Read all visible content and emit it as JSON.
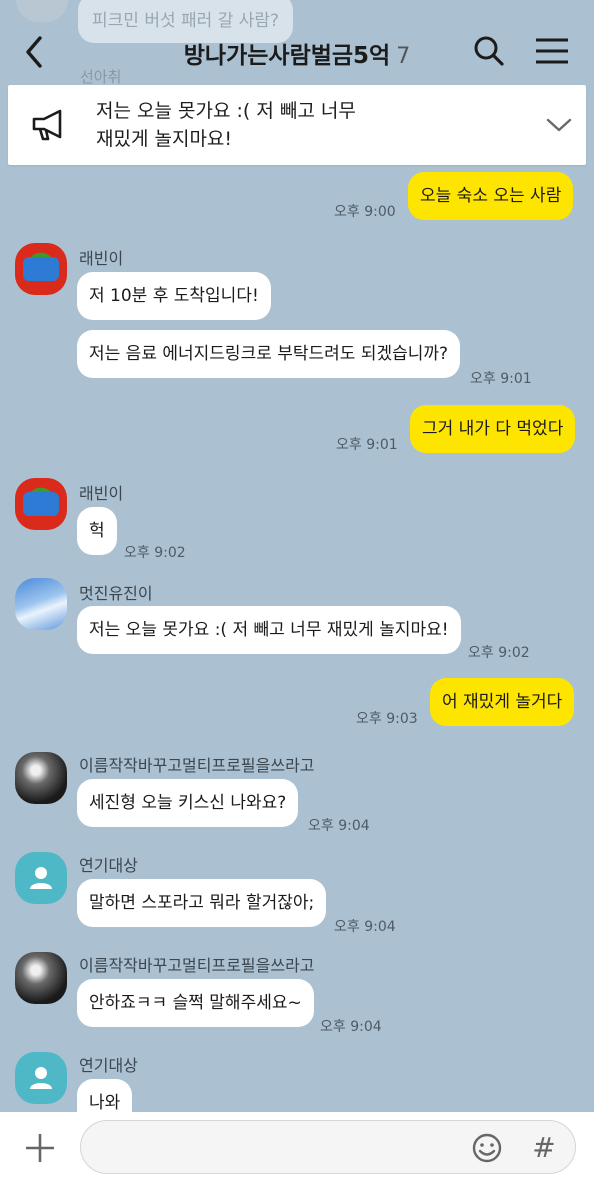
{
  "previous": {
    "text": "피크민 버섯 패러 갈 사람?",
    "sender": "선아취"
  },
  "header": {
    "title": "방나가는사람벌금5억",
    "member_count": "7"
  },
  "notice": {
    "text_line1": "저는 오늘 못가요 :( 저 빼고 너무",
    "text_line2": "재밌게 놀지마요!"
  },
  "messages": [
    {
      "type": "mine",
      "text": "오늘 숙소 오는 사람",
      "time": "오후 9:00"
    },
    {
      "type": "theirs",
      "sender": "래빈이",
      "text": "저 10분 후 도착입니다!",
      "time": ""
    },
    {
      "type": "theirs",
      "sender": "",
      "text": "저는 음료 에너지드링크로 부탁드려도 되겠습니까?",
      "time": "오후 9:01"
    },
    {
      "type": "mine",
      "text": "그거 내가 다 먹었다",
      "time": "오후 9:01"
    },
    {
      "type": "theirs",
      "sender": "래빈이",
      "text": "헉",
      "time": "오후 9:02"
    },
    {
      "type": "theirs",
      "sender": "멋진유진이",
      "text": "저는 오늘 못가요 :( 저 빼고 너무 재밌게 놀지마요!",
      "time": "오후 9:02"
    },
    {
      "type": "mine",
      "text": "어 재밌게 놀거다",
      "time": "오후 9:03"
    },
    {
      "type": "theirs",
      "sender": "이름작작바꾸고멀티프로필을쓰라고",
      "text": "세진형 오늘 키스신 나와요?",
      "time": "오후 9:04"
    },
    {
      "type": "theirs",
      "sender": "연기대상",
      "text": "말하면 스포라고 뭐라 할거잖아;",
      "time": "오후 9:04"
    },
    {
      "type": "theirs",
      "sender": "이름작작바꾸고멀티프로필을쓰라고",
      "text": "안하죠ㅋㅋ 슬쩍 말해주세요~",
      "time": "오후 9:04"
    },
    {
      "type": "theirs",
      "sender": "연기대상",
      "text": "나와",
      "time": ""
    }
  ],
  "input": {
    "placeholder": "",
    "hash_label": "#"
  },
  "colors": {
    "background": "#abc1d1",
    "my_bubble": "#fee500",
    "their_bubble": "#ffffff",
    "default_avatar": "#4fb8c7"
  }
}
